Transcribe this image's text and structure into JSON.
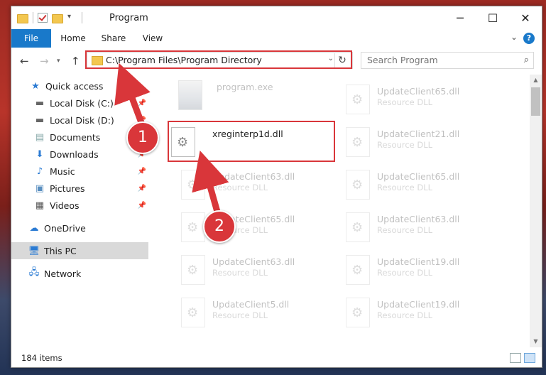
{
  "window": {
    "title": "Program",
    "buttons": {
      "minimize": "─",
      "maximize": "☐",
      "close": "✕"
    }
  },
  "ribbon": {
    "tabs": [
      "File",
      "Home",
      "Share",
      "View"
    ],
    "help": "?"
  },
  "navigation": {
    "address": "C:\\Program Files\\Program Directory",
    "search_placeholder": "Search Program"
  },
  "sidebar": {
    "items": [
      {
        "label": "Quick access",
        "icon": "star-icon"
      },
      {
        "label": "Local Disk (C:)",
        "icon": "drive-icon"
      },
      {
        "label": "Local Disk (D:)",
        "icon": "drive-icon"
      },
      {
        "label": "Documents",
        "icon": "documents-icon"
      },
      {
        "label": "Downloads",
        "icon": "download-icon"
      },
      {
        "label": "Music",
        "icon": "music-icon"
      },
      {
        "label": "Pictures",
        "icon": "pictures-icon"
      },
      {
        "label": "Videos",
        "icon": "videos-icon"
      },
      {
        "label": "OneDrive",
        "icon": "cloud-icon"
      },
      {
        "label": "This PC",
        "icon": "computer-icon"
      },
      {
        "label": "Network",
        "icon": "network-icon"
      }
    ]
  },
  "files": [
    {
      "name": "program.exe",
      "type": ""
    },
    {
      "name": "UpdateClient65.dll",
      "type": "Resource DLL"
    },
    {
      "name": "xreginterp1d.dll",
      "type": ""
    },
    {
      "name": "UpdateClient21.dll",
      "type": "Resource DLL"
    },
    {
      "name": "UpdateClient63.dll",
      "type": "Resource DLL"
    },
    {
      "name": "UpdateClient65.dll",
      "type": "Resource DLL"
    },
    {
      "name": "UpdateClient65.dll",
      "type": "Resource DLL"
    },
    {
      "name": "UpdateClient63.dll",
      "type": "Resource DLL"
    },
    {
      "name": "UpdateClient63.dll",
      "type": "Resource DLL"
    },
    {
      "name": "UpdateClient19.dll",
      "type": "Resource DLL"
    },
    {
      "name": "UpdateClient5.dll",
      "type": "Resource DLL"
    },
    {
      "name": "UpdateClient19.dll",
      "type": "Resource DLL"
    }
  ],
  "annotations": {
    "step1": "1",
    "step2": "2"
  },
  "status": {
    "item_count": "184 items"
  },
  "colors": {
    "accent": "#1979ca",
    "highlight": "#d9363a"
  }
}
